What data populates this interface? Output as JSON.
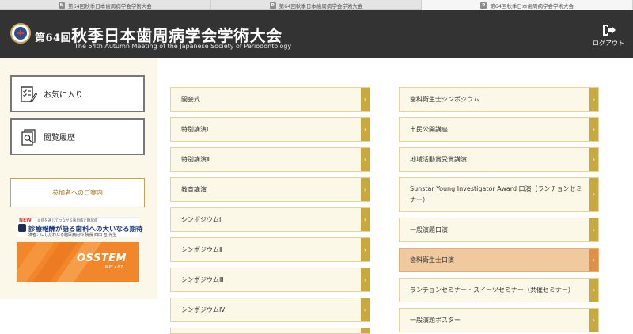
{
  "tabs": [
    {
      "icon_letter": "N",
      "label": "第64回秋季日本歯周病学会学術大会",
      "active": false
    },
    {
      "icon_letter": "P",
      "label": "第64回秋季日本歯周病学会学術大会",
      "active": false
    },
    {
      "icon_letter": "P",
      "label": "第64回秋季日本歯周病学会学術大会",
      "active": true
    }
  ],
  "header": {
    "title_prefix": "第64回",
    "title_main": "秋季日本歯周病学会学術大会",
    "subtitle": "The 64th Autumn Meeting of the Japanese Society of Periodontology",
    "logout_label": "ログアウト",
    "logout_icon": "logout-icon",
    "background": "#333333"
  },
  "sidebar": {
    "favorites_label": "お気に入り",
    "favorites_icon": "favorites-checklist-icon",
    "history_label": "閲覧履歴",
    "history_icon": "history-documents-icon",
    "guide_label": "参加者へのご案内",
    "banner1": {
      "new_label": "NEW",
      "small_text": "炎症を通じてつながる歯周病と糖尿病",
      "headline": "診療報酬が語る歯科への大いなる期待",
      "lecturer": "演者：にしだわたる糖尿病内科 院長 西田 亙 先生"
    },
    "banner2": {
      "brand": "OSSTEM",
      "sub": "IMPLANT",
      "color": "#f2862a"
    }
  },
  "menu_left": [
    {
      "label": "開会式"
    },
    {
      "label": "特別講演Ⅰ"
    },
    {
      "label": "特別講演Ⅱ"
    },
    {
      "label": "教育講演"
    },
    {
      "label": "シンポジウムⅠ"
    },
    {
      "label": "シンポジウムⅡ"
    },
    {
      "label": "シンポジウムⅢ"
    },
    {
      "label": "シンポジウムⅣ"
    }
  ],
  "menu_right": [
    {
      "label": "歯科衛生士シンポジウム"
    },
    {
      "label": "市民公開講座"
    },
    {
      "label": "地域活動賞受賞講演"
    },
    {
      "label": "Sunstar Young Investigator Award 口演（ランチョンセミナー）"
    },
    {
      "label": "一般演題口演"
    },
    {
      "label": "歯科衛生士口演",
      "highlighted": true
    },
    {
      "label": "ランチョンセミナー・スイーツセミナー（共催セミナー）"
    },
    {
      "label": "一般演題ポスター"
    }
  ],
  "arrow_glyph": "›",
  "colors": {
    "accent_gold": "#c9a93f",
    "item_background": "#fcf8e8",
    "highlight_background": "#f0ca9e",
    "highlight_arrow": "#e08f45",
    "sidebar_background": "#fcf8e9"
  }
}
